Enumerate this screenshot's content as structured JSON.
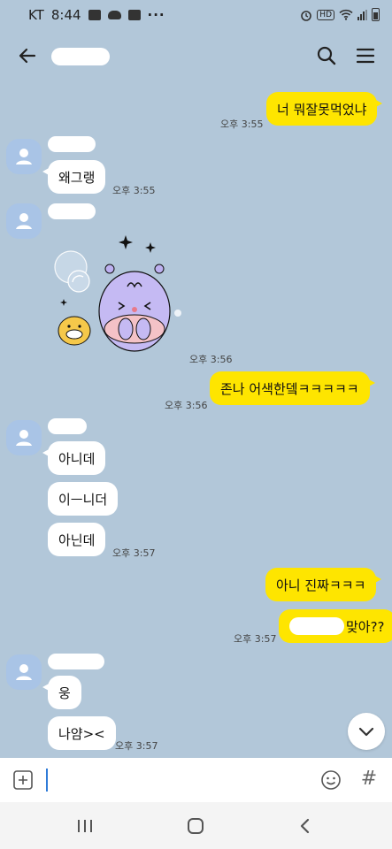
{
  "status_bar": {
    "carrier": "KT",
    "time": "8:44",
    "dots": "···",
    "hd": "HD"
  },
  "header": {
    "chat_name": ""
  },
  "messages": [
    {
      "from": "me",
      "text": "너 뭐잘못먹었냐",
      "time": "오후 3:55"
    },
    {
      "from": "other",
      "text": "왜그랭",
      "time": "오후 3:55"
    },
    {
      "from": "other",
      "type": "sticker",
      "time": "오후 3:56"
    },
    {
      "from": "me",
      "text": "존나 어색한뎈ㅋㅋㅋㅋㅋ",
      "time": "오후 3:56"
    },
    {
      "from": "other",
      "text": "아니데"
    },
    {
      "from": "other",
      "text": "이ㅡ니더"
    },
    {
      "from": "other",
      "text": "아닌데",
      "time": "오후 3:57"
    },
    {
      "from": "me",
      "text": "아니 진짜ㅋㅋㅋ"
    },
    {
      "from": "me",
      "redacted_prefix": "",
      "text": "맞아??",
      "time": "오후 3:57"
    },
    {
      "from": "other",
      "text": "웅"
    },
    {
      "from": "other",
      "text": "나얌><",
      "time": "오후 3:57"
    }
  ],
  "input": {
    "placeholder": ""
  },
  "icons": {
    "back": "arrow-left-icon",
    "search": "search-icon",
    "menu": "hamburger-menu-icon",
    "add": "plus-square-icon",
    "emoji": "smiley-icon",
    "hash": "hash-icon",
    "scroll": "chevron-down-icon",
    "avatar": "person-icon"
  },
  "hash_glyph": "#",
  "colors": {
    "background": "#b2c7d9",
    "my_bubble": "#fee500",
    "other_bubble": "#ffffff",
    "avatar": "#a9c4e6",
    "caret": "#2f7bd8"
  }
}
